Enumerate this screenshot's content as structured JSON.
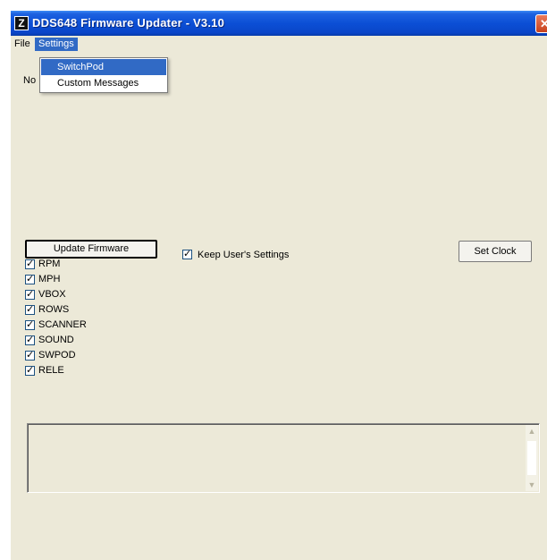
{
  "window": {
    "title": "DDS648 Firmware Updater - V3.10",
    "app_icon": "Z",
    "close_glyph": "✕"
  },
  "menubar": {
    "items": [
      "File",
      "Settings"
    ]
  },
  "settings_menu": {
    "items": [
      "SwitchPod",
      "Custom Messages"
    ],
    "highlighted": "SwitchPod"
  },
  "status_label": "No",
  "buttons": {
    "update_firmware": "Update Firmware",
    "set_clock": "Set Clock"
  },
  "keep_settings": {
    "label": "Keep User's Settings",
    "checked": true
  },
  "options": [
    {
      "label": "RPM",
      "checked": true
    },
    {
      "label": "MPH",
      "checked": true
    },
    {
      "label": "VBOX",
      "checked": true
    },
    {
      "label": "ROWS",
      "checked": true
    },
    {
      "label": "SCANNER",
      "checked": true
    },
    {
      "label": "SOUND",
      "checked": true
    },
    {
      "label": "SWPOD",
      "checked": true
    },
    {
      "label": "RELE",
      "checked": true
    }
  ],
  "log_text": "",
  "colors": {
    "title_bar": "#0b4fd6",
    "menu_highlight": "#316ac5",
    "window_bg": "#ece9d8"
  }
}
